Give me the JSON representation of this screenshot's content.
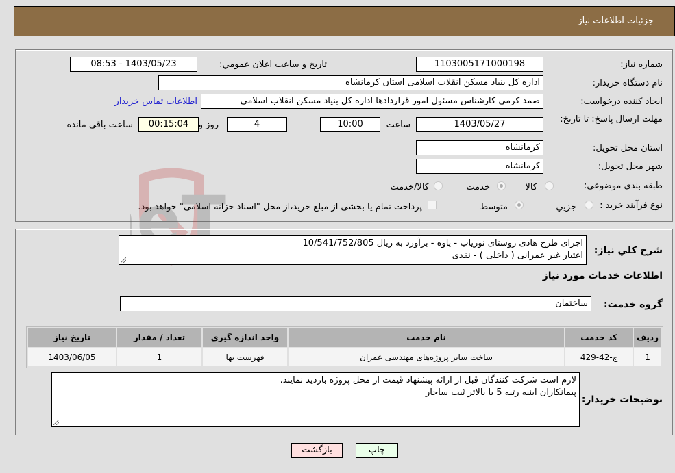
{
  "header": {
    "title": "جزئيات اطلاعات نياز"
  },
  "details": {
    "need_number_label": "شماره نياز:",
    "need_number": "1103005171000198",
    "announce_label": "تاريخ و ساعت اعلان عمومي:",
    "announce_value": "1403/05/23 - 08:53",
    "buyer_org_label": "نام دستگاه خريدار:",
    "buyer_org": "اداره کل بنیاد مسکن انقلاب اسلامی استان کرمانشاه",
    "creator_label": "ايجاد کننده درخواست:",
    "creator": "صمد کرمی کارشناس مسئول امور قراردادها اداره کل بنیاد مسکن انقلاب اسلامی",
    "contact_link": "اطلاعات تماس خريدار",
    "deadline_label": "مهلت ارسال پاسخ: تا تاريخ:",
    "deadline_date": "1403/05/27",
    "time_label": "ساعت",
    "deadline_time": "10:00",
    "days_value": "4",
    "days_label": "روز و",
    "remaining_time": "00:15:04",
    "remaining_label": "ساعت باقي مانده",
    "province_label": "استان محل تحويل:",
    "province": "کرمانشاه",
    "city_label": "شهر محل تحويل:",
    "city": "کرمانشاه",
    "category_label": "طبقه بندی موضوعی:",
    "category_options": [
      {
        "label": "کالا",
        "selected": false
      },
      {
        "label": "خدمت",
        "selected": true
      },
      {
        "label": "کالا/خدمت",
        "selected": false
      }
    ],
    "process_label": "نوع فرآيند خريد :",
    "process_options": [
      {
        "label": "جزيي",
        "selected": false
      },
      {
        "label": "متوسط",
        "selected": true
      }
    ],
    "treasury_note": "پرداخت تمام يا بخشی از مبلغ خريد،از محل \"اسناد خزانه اسلامی\" خواهد بود."
  },
  "description": {
    "label": "شرح كلي نياز:",
    "lines": [
      "اجرای طرح هادی روستای نوریاب - پاوه - برآورد به ریال 10/541/752/805",
      "اعتبار غیر عمرانی ( داخلی ) -  نقدی"
    ]
  },
  "services": {
    "section_title": "اطلاعات خدمات مورد نياز",
    "group_label": "گروه خدمت:",
    "group_value": "ساختمان",
    "table": {
      "headers": [
        "رديف",
        "کد خدمت",
        "نام خدمت",
        "واحد اندازه گيری",
        "تعداد / مقدار",
        "تاريخ نياز"
      ],
      "rows": [
        [
          "1",
          "ج-42-429",
          "ساخت سایر پروژه‌های مهندسی عمران",
          "فهرست بها",
          "1",
          "1403/06/05"
        ]
      ]
    }
  },
  "buyer_notes": {
    "label": "توضيحات خريدار:",
    "lines": [
      "لازم است شرکت کنندگان قبل از ارائه پیشنهاد قیمت از محل پروژه بازدید نمایند.",
      " پیمانکاران ابنیه رتبه 5 یا بالاتر ثبت ساجار"
    ]
  },
  "buttons": {
    "print": "چاپ",
    "back": "بازگشت"
  },
  "watermark": {
    "text": "AriaTender.neT"
  },
  "colors": {
    "header_bg": "#8c6d45",
    "print_bg": "#eaffea",
    "back_bg": "#ffe0e0",
    "link": "#2020d0"
  }
}
